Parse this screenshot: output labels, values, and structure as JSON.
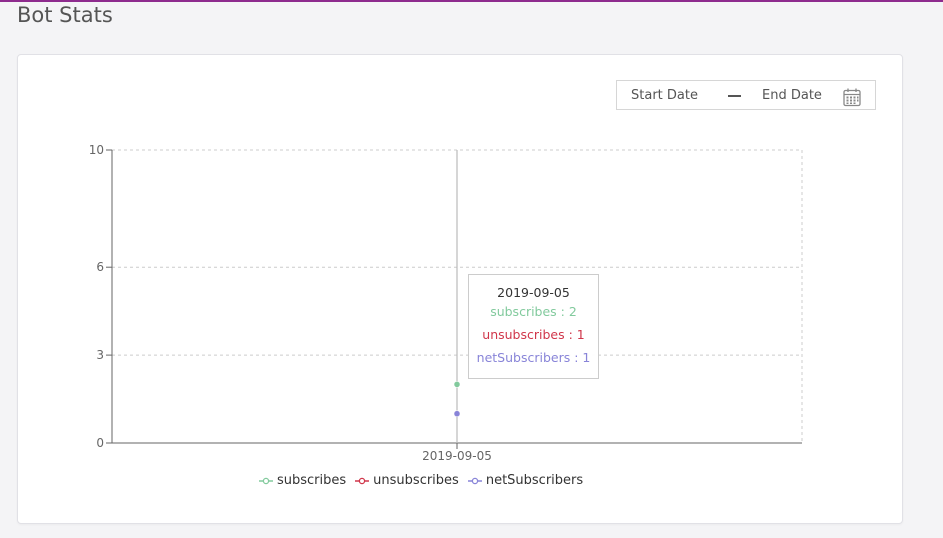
{
  "page": {
    "title": "Bot Stats"
  },
  "date_range": {
    "start_label": "Start Date",
    "end_label": "End Date",
    "icon": "calendar-icon"
  },
  "tooltip": {
    "title": "2019-09-05",
    "rows": [
      {
        "name": "subscribes",
        "text": "subscribes : 2",
        "color": "#82ca9d"
      },
      {
        "name": "unsubscribes",
        "text": "unsubscribes : 1",
        "color": "#d0364a"
      },
      {
        "name": "netSubscribers",
        "text": "netSubscribers : 1",
        "color": "#8884d8"
      }
    ]
  },
  "chart_data": {
    "type": "line",
    "x": [
      "2019-09-05"
    ],
    "ylim": [
      0,
      10
    ],
    "yticks": [
      0,
      3,
      6,
      10
    ],
    "grid": true,
    "legend_placement": "bottom",
    "series": [
      {
        "name": "subscribes",
        "values": [
          2
        ],
        "color": "#82ca9d"
      },
      {
        "name": "unsubscribes",
        "values": [
          1
        ],
        "color": "#d0364a"
      },
      {
        "name": "netSubscribers",
        "values": [
          1
        ],
        "color": "#8884d8"
      }
    ]
  }
}
